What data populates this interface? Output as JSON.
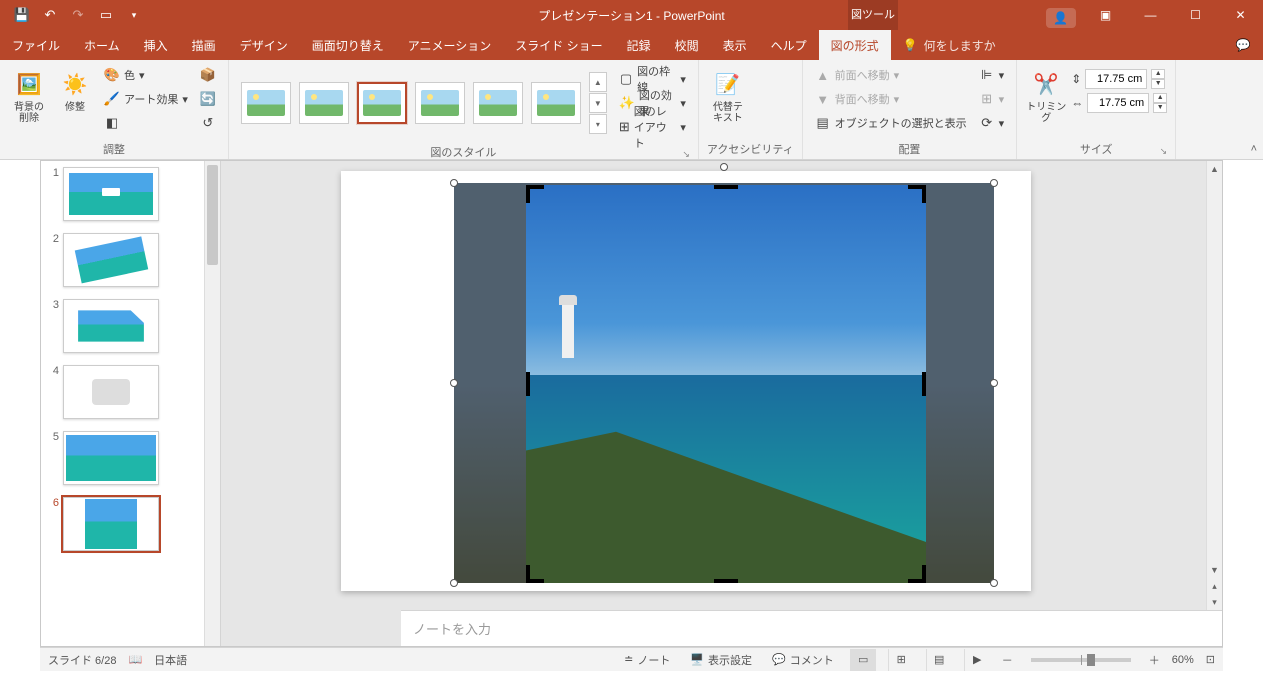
{
  "titlebar": {
    "doc_title": "プレゼンテーション1",
    "app_name": "PowerPoint",
    "title": "プレゼンテーション1  -  PowerPoint",
    "contextual_label": "図ツール"
  },
  "tabs": {
    "file": "ファイル",
    "home": "ホーム",
    "insert": "挿入",
    "draw": "描画",
    "design": "デザイン",
    "transitions": "画面切り替え",
    "animations": "アニメーション",
    "slideshow": "スライド ショー",
    "record": "記録",
    "review": "校閲",
    "view": "表示",
    "help": "ヘルプ",
    "picture_format": "図の形式",
    "tellme": "何をしますか"
  },
  "ribbon": {
    "remove_bg": {
      "line1": "背景の",
      "line2": "削除"
    },
    "corrections": "修整",
    "color": "色",
    "artistic": "アート効果",
    "group_adjust": "調整",
    "group_styles": "図のスタイル",
    "border": "図の枠線",
    "effects": "図の効果",
    "layout": "図のレイアウト",
    "alt_text": {
      "line1": "代替テ",
      "line2": "キスト"
    },
    "group_access": "アクセシビリティ",
    "bring_forward": "前面へ移動",
    "send_backward": "背面へ移動",
    "selection_pane": "オブジェクトの選択と表示",
    "group_arrange": "配置",
    "crop": "トリミング",
    "group_size": "サイズ",
    "height": "17.75 cm",
    "width": "17.75 cm"
  },
  "thumbnails": [
    {
      "num": "1"
    },
    {
      "num": "2"
    },
    {
      "num": "3"
    },
    {
      "num": "4"
    },
    {
      "num": "5"
    },
    {
      "num": "6"
    }
  ],
  "notes_placeholder": "ノートを入力",
  "status": {
    "slide_indicator": "スライド 6/28",
    "language": "日本語",
    "notes_btn": "ノート",
    "display_settings": "表示設定",
    "comments": "コメント",
    "zoom_pct": "60%"
  }
}
